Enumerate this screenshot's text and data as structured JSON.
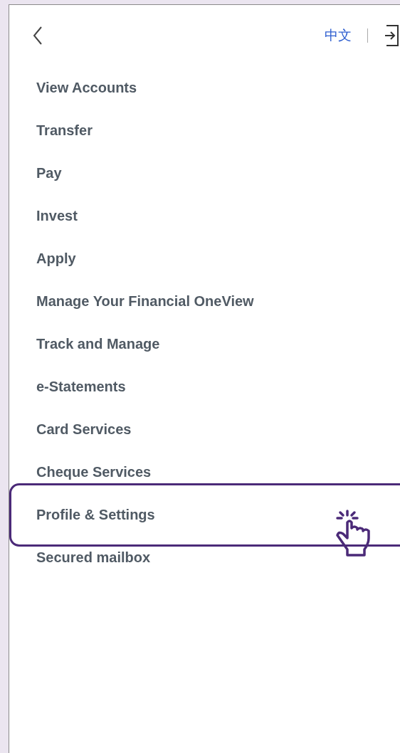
{
  "header": {
    "language_link": "中文"
  },
  "menu": [
    {
      "label": "View Accounts",
      "selected": false
    },
    {
      "label": "Transfer",
      "selected": false
    },
    {
      "label": "Pay",
      "selected": false
    },
    {
      "label": "Invest",
      "selected": false
    },
    {
      "label": "Apply",
      "selected": false
    },
    {
      "label": "Manage Your Financial OneView",
      "selected": false
    },
    {
      "label": "Track and Manage",
      "selected": false
    },
    {
      "label": "e-Statements",
      "selected": false
    },
    {
      "label": "Card Services",
      "selected": false
    },
    {
      "label": "Cheque Services",
      "selected": false
    },
    {
      "label": "Profile & Settings",
      "selected": true
    },
    {
      "label": "Secured mailbox",
      "selected": false
    }
  ]
}
